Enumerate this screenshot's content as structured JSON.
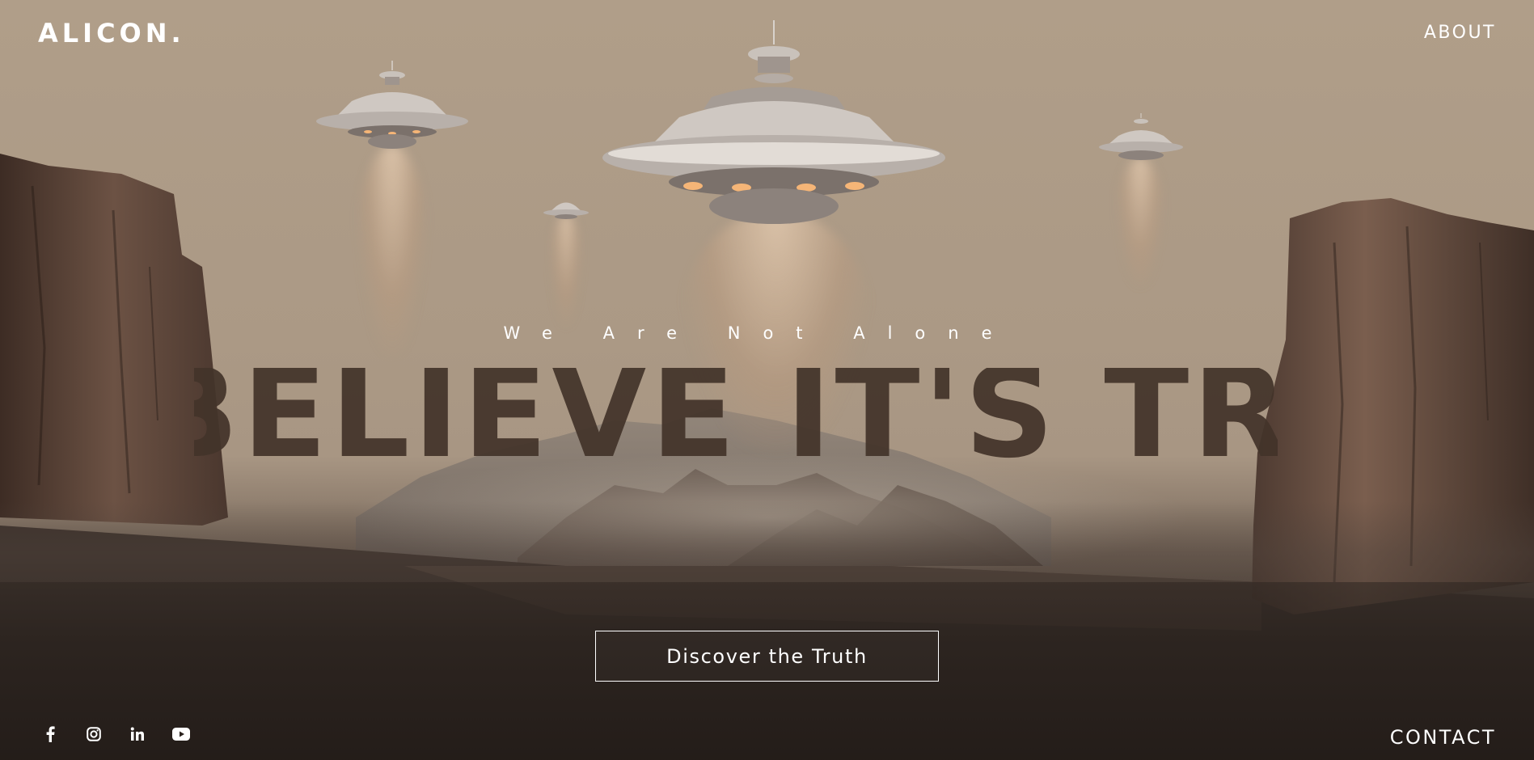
{
  "brand": {
    "logo_text": "ALICON."
  },
  "nav": {
    "about_label": "ABOUT",
    "contact_label": "CONTACT"
  },
  "hero": {
    "tagline": "We Are Not Alone",
    "headline": "BELIEVE IT'S TRUE",
    "cta_label": "Discover the Truth"
  },
  "social": {
    "icons": [
      "facebook-icon",
      "instagram-icon",
      "linkedin-icon",
      "youtube-icon"
    ]
  },
  "colors": {
    "sky": "#af9d87",
    "headline": "#43342a",
    "text": "#ffffff"
  }
}
